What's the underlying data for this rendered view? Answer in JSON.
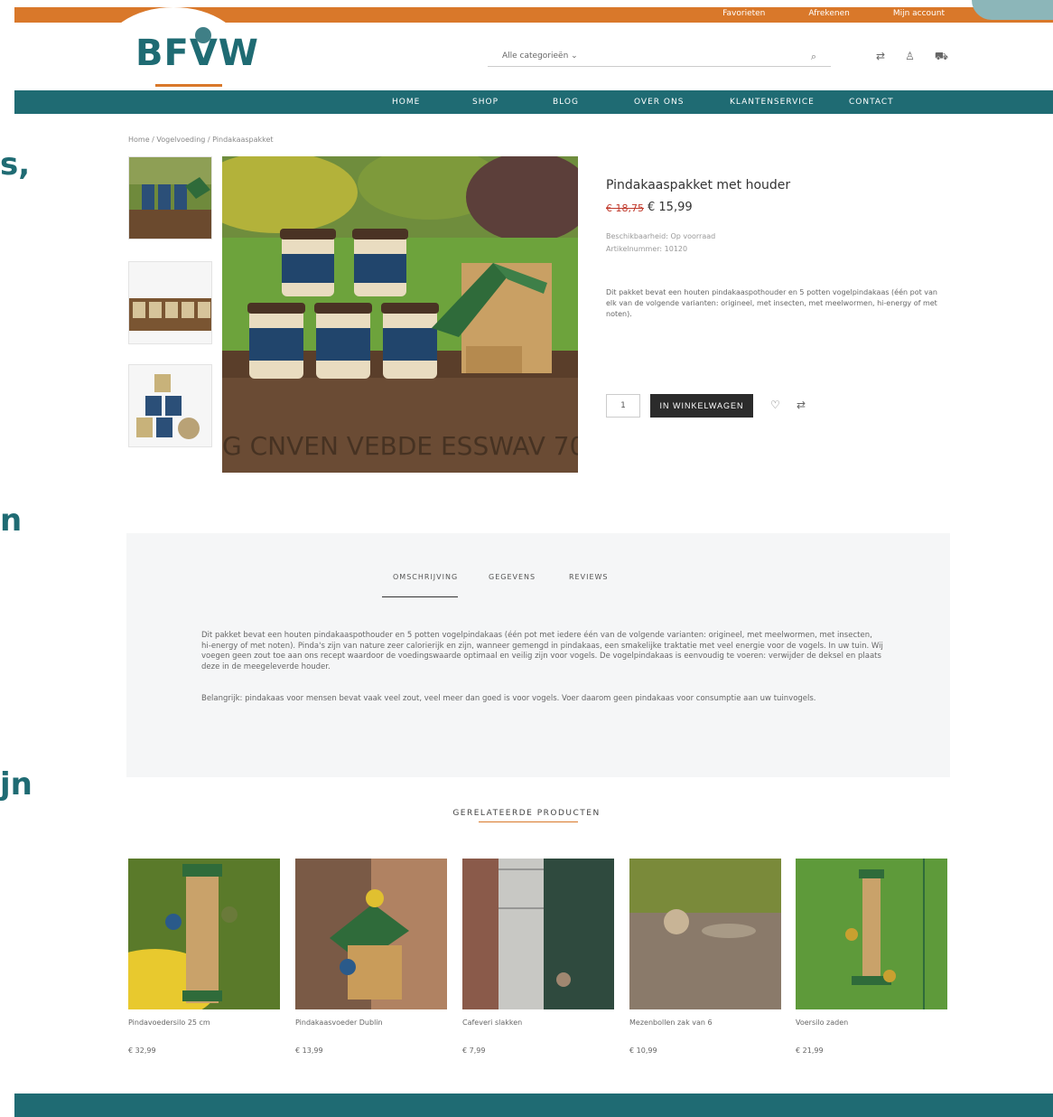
{
  "edge_text": [
    "s,",
    "n",
    "jn"
  ],
  "topbar": {
    "links": [
      "Favorieten",
      "Afrekenen",
      "Mijn account"
    ]
  },
  "logo": {
    "text": "BFVW"
  },
  "search": {
    "category": "Alle categorieën",
    "placeholder": ""
  },
  "nav": [
    "HOME",
    "SHOP",
    "BLOG",
    "OVER ONS",
    "KLANTENSERVICE",
    "CONTACT"
  ],
  "breadcrumb": "Home  /  Vogelvoeding  /  Pindakaaspakket",
  "product": {
    "title": "Pindakaaspakket met houder",
    "old_price": "€ 18,75",
    "new_price": "€ 15,99",
    "availability": "Beschikbaarheid: Op voorraad",
    "sku": "Artikelnummer: 10120",
    "description": "Dit pakket bevat een houten pindakaaspothouder en 5 potten vogelpindakaas (één pot van elk van de volgende varianten: origineel, met insecten, met meelwormen, hi-energy of met noten).",
    "qty": "1",
    "cart_label": "IN WINKELWAGEN"
  },
  "tabs": {
    "labels": [
      "OMSCHRIJVING",
      "GEGEVENS",
      "REVIEWS"
    ],
    "desc1": "Dit pakket bevat een houten pindakaaspothouder en 5 potten vogelpindakaas (één pot met iedere één van de volgende varianten: origineel, met meelwormen, met insecten, hi-energy of met noten). Pinda's zijn van nature zeer calorierijk en zijn, wanneer gemengd in pindakaas, een smakelijke traktatie met veel energie voor de vogels. In uw tuin. Wij voegen geen zout toe aan ons recept waardoor de voedingswaarde optimaal en veilig zijn voor vogels. De vogelpindakaas is eenvoudig te voeren: verwijder de deksel en plaats deze in de meegeleverde houder.",
    "desc2": "Belangrijk: pindakaas voor mensen bevat vaak veel zout, veel meer dan goed is voor vogels. Voer daarom geen pindakaas voor consumptie aan uw tuinvogels."
  },
  "related": {
    "title": "GERELATEERDE PRODUCTEN",
    "items": [
      {
        "name": "Pindavoedersilo 25 cm",
        "price": "€ 32,99"
      },
      {
        "name": "Pindakaasvoeder Dublin",
        "price": "€ 13,99"
      },
      {
        "name": "Cafeveri slakken",
        "price": "€ 7,99"
      },
      {
        "name": "Mezenbollen zak van 6",
        "price": "€ 10,99"
      },
      {
        "name": "Voersilo zaden",
        "price": "€ 21,99"
      }
    ]
  }
}
